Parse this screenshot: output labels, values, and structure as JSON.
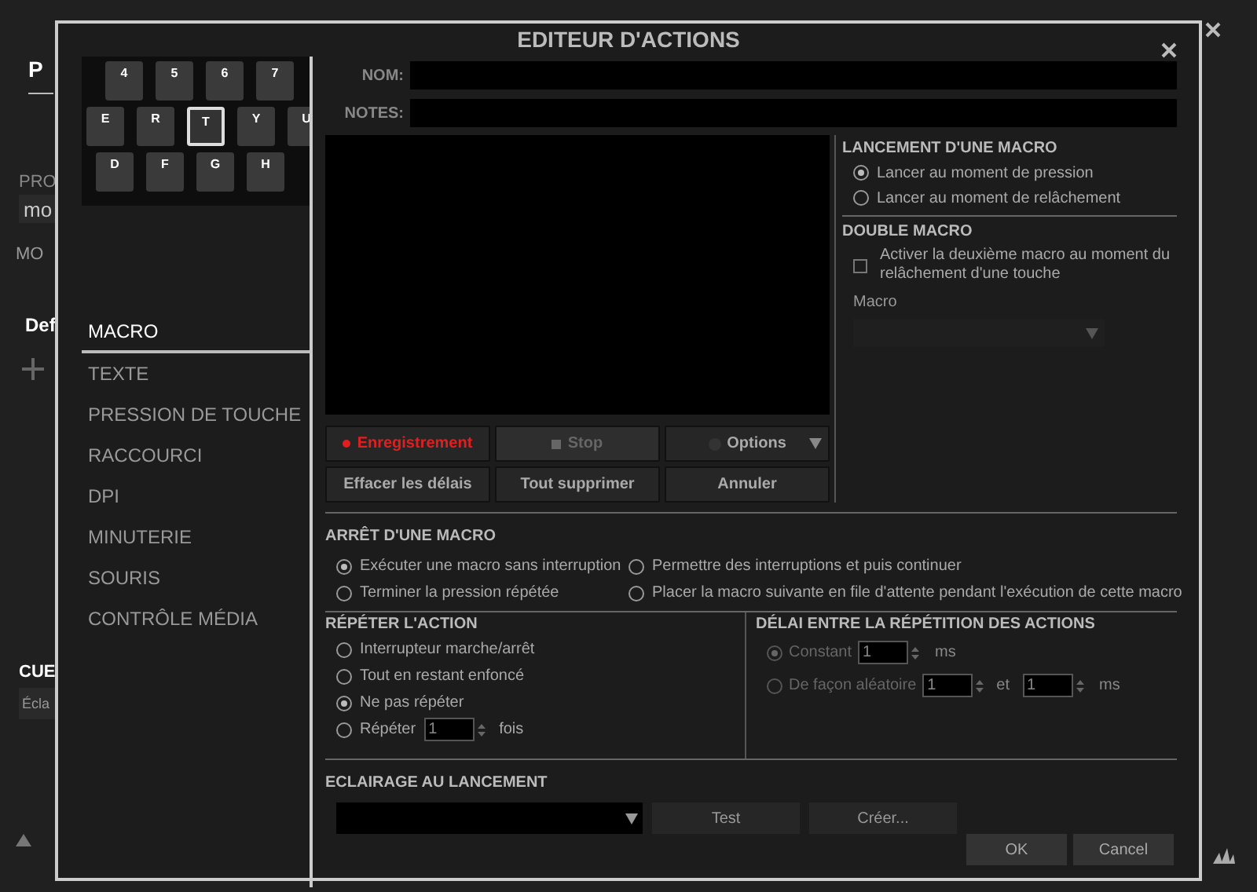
{
  "background_app": {
    "texts": [
      "P",
      "PRO",
      "mo",
      "MO",
      "Def",
      "CUE",
      "Écla"
    ]
  },
  "dialog": {
    "title": "EDITEUR D'ACTIONS",
    "keyboard": {
      "rows": [
        [
          {
            "label": "4",
            "selected": false
          },
          {
            "label": "5",
            "selected": false
          },
          {
            "label": "6",
            "selected": false
          },
          {
            "label": "7",
            "selected": false
          }
        ],
        [
          {
            "label": "E",
            "selected": false
          },
          {
            "label": "R",
            "selected": false
          },
          {
            "label": "T",
            "selected": true
          },
          {
            "label": "Y",
            "selected": false
          },
          {
            "label": "U",
            "selected": false
          }
        ],
        [
          {
            "label": "D",
            "selected": false
          },
          {
            "label": "F",
            "selected": false
          },
          {
            "label": "G",
            "selected": false
          },
          {
            "label": "H",
            "selected": false
          }
        ]
      ]
    },
    "action_types": [
      {
        "label": "MACRO",
        "selected": true
      },
      {
        "label": "TEXTE",
        "selected": false
      },
      {
        "label": "PRESSION DE TOUCHE",
        "selected": false
      },
      {
        "label": "RACCOURCI",
        "selected": false
      },
      {
        "label": "DPI",
        "selected": false
      },
      {
        "label": "MINUTERIE",
        "selected": false
      },
      {
        "label": "SOURIS",
        "selected": false
      },
      {
        "label": "CONTRÔLE MÉDIA",
        "selected": false
      }
    ],
    "fields": [
      {
        "label": "NOM:"
      },
      {
        "label": "NOTES:"
      }
    ],
    "macro_buttons": [
      {
        "label": "Enregistrement",
        "kind": "record",
        "disabled": false
      },
      {
        "label": "Stop",
        "kind": "stop",
        "disabled": true
      },
      {
        "label": "Options",
        "kind": "dropdown",
        "disabled": false
      },
      {
        "label": "Effacer les délais",
        "kind": "plain",
        "disabled": false
      },
      {
        "label": "Tout supprimer",
        "kind": "plain",
        "disabled": false
      },
      {
        "label": "Annuler",
        "kind": "plain",
        "disabled": false
      }
    ],
    "launch": {
      "title": "LANCEMENT D'UNE MACRO",
      "options": [
        {
          "label": "Lancer au moment de pression",
          "selected": true
        },
        {
          "label": "Lancer au moment de relâchement",
          "selected": false
        }
      ]
    },
    "double_macro": {
      "title": "DOUBLE MACRO",
      "checkbox": {
        "label": "Activer la deuxième macro au moment du relâchement d'une touche",
        "checked": false
      },
      "macro_label": "Macro",
      "dropdown_disabled": true
    },
    "stop": {
      "title": "ARRÊT D'UNE MACRO",
      "options": [
        {
          "label": "Exécuter une macro sans interruption",
          "selected": true
        },
        {
          "label": "Permettre des interruptions et puis continuer",
          "selected": false
        },
        {
          "label": "Terminer la pression répétée",
          "selected": false
        },
        {
          "label": "Placer la macro suivante en file d'attente pendant l'exécution de cette macro",
          "selected": false
        }
      ]
    },
    "repeat": {
      "title": "RÉPÉTER L'ACTION",
      "options": [
        {
          "label": "Interrupteur marche/arrêt",
          "selected": false,
          "kind": "plain"
        },
        {
          "label": "Tout en restant enfoncé",
          "selected": false,
          "kind": "plain"
        },
        {
          "label": "Ne pas répéter",
          "selected": true,
          "kind": "plain"
        },
        {
          "label": "Répéter",
          "selected": false,
          "kind": "count",
          "value": "1",
          "suffix": "fois"
        }
      ]
    },
    "delay": {
      "title": "DÉLAI ENTRE LA RÉPÉTITION DES ACTIONS",
      "disabled": true,
      "options": [
        {
          "label": "Constant",
          "selected": true,
          "values": [
            "1"
          ],
          "unit": "ms"
        },
        {
          "label": "De façon aléatoire",
          "selected": false,
          "values": [
            "1",
            "1"
          ],
          "joiner": "et",
          "unit": "ms"
        }
      ]
    },
    "lighting": {
      "title": "ECLAIRAGE AU LANCEMENT",
      "buttons": [
        "Test",
        "Créer..."
      ]
    },
    "footer_buttons": [
      "OK",
      "Cancel"
    ]
  }
}
